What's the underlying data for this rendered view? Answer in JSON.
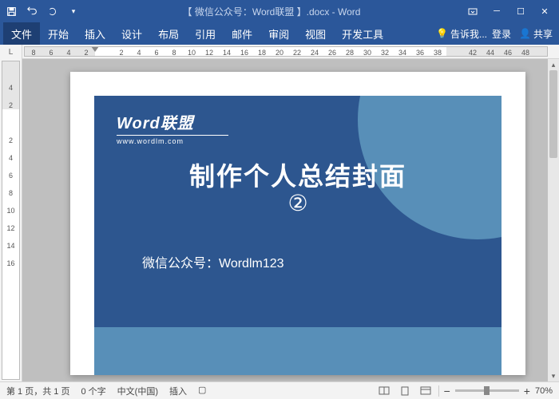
{
  "titlebar": {
    "doc_title": "【 微信公众号：Word联盟 】.docx - Word"
  },
  "tabs": {
    "file": "文件",
    "home": "开始",
    "insert": "插入",
    "design": "设计",
    "layout": "布局",
    "references": "引用",
    "mailings": "邮件",
    "review": "审阅",
    "view": "视图",
    "dev": "开发工具",
    "tellme": "告诉我...",
    "login": "登录",
    "share": "共享"
  },
  "ruler_corner": "L",
  "hruler": [
    "8",
    "6",
    "4",
    "2",
    "",
    "2",
    "4",
    "6",
    "8",
    "10",
    "12",
    "14",
    "16",
    "18",
    "20",
    "22",
    "24",
    "26",
    "28",
    "30",
    "32",
    "34",
    "36",
    "38",
    "",
    "42",
    "44",
    "46",
    "48"
  ],
  "vruler": [
    "",
    "4",
    "2",
    "",
    "2",
    "4",
    "6",
    "8",
    "10",
    "12",
    "14",
    "16"
  ],
  "cover": {
    "logo_main": "Word联盟",
    "logo_sub": "www.wordlm.com",
    "title": "制作个人总结封面",
    "number": "②",
    "wechat": "微信公众号：Wordlm123"
  },
  "status": {
    "page": "第 1 页，共 1 页",
    "words": "0 个字",
    "lang": "中文(中国)",
    "insert": "插入",
    "zoom_minus": "−",
    "zoom_plus": "+",
    "zoom": "70%"
  }
}
